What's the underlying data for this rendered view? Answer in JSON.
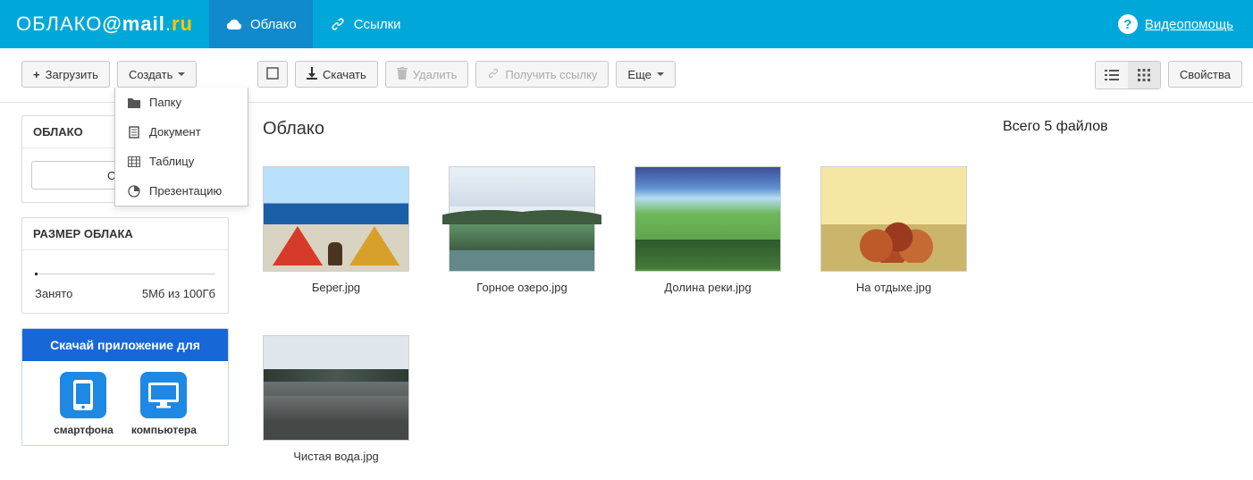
{
  "logo": {
    "word": "ОБЛАКО",
    "mail": "mail",
    "ru": "ru"
  },
  "topnav": {
    "cloud": "Облако",
    "links": "Ссылки"
  },
  "videohelp": "Видеопомощь",
  "toolbar": {
    "upload": "Загрузить",
    "create": "Создать",
    "download": "Скачать",
    "delete": "Удалить",
    "getlink": "Получить ссылку",
    "more": "Еще",
    "properties": "Свойства"
  },
  "create_menu": {
    "folder": "Папку",
    "document": "Документ",
    "spreadsheet": "Таблицу",
    "presentation": "Презентацию"
  },
  "sidebar": {
    "cloud_panel_title": "ОБЛАКО",
    "service_button_truncated": "Служб",
    "size_panel_title": "РАЗМЕР ОБЛАКА",
    "used_label": "Занято",
    "used_value": "5Мб из 100Гб",
    "promo_title": "Скачай приложение для",
    "promo_phone": "смартфона",
    "promo_desktop": "компьютера"
  },
  "main": {
    "title": "Облако",
    "files": [
      {
        "name": "Берег.jpg"
      },
      {
        "name": "Горное озеро.jpg"
      },
      {
        "name": "Долина реки.jpg"
      },
      {
        "name": "На отдыхе.jpg"
      },
      {
        "name": "Чистая вода.jpg"
      }
    ]
  },
  "info": {
    "summary": "Всего 5 файлов"
  }
}
